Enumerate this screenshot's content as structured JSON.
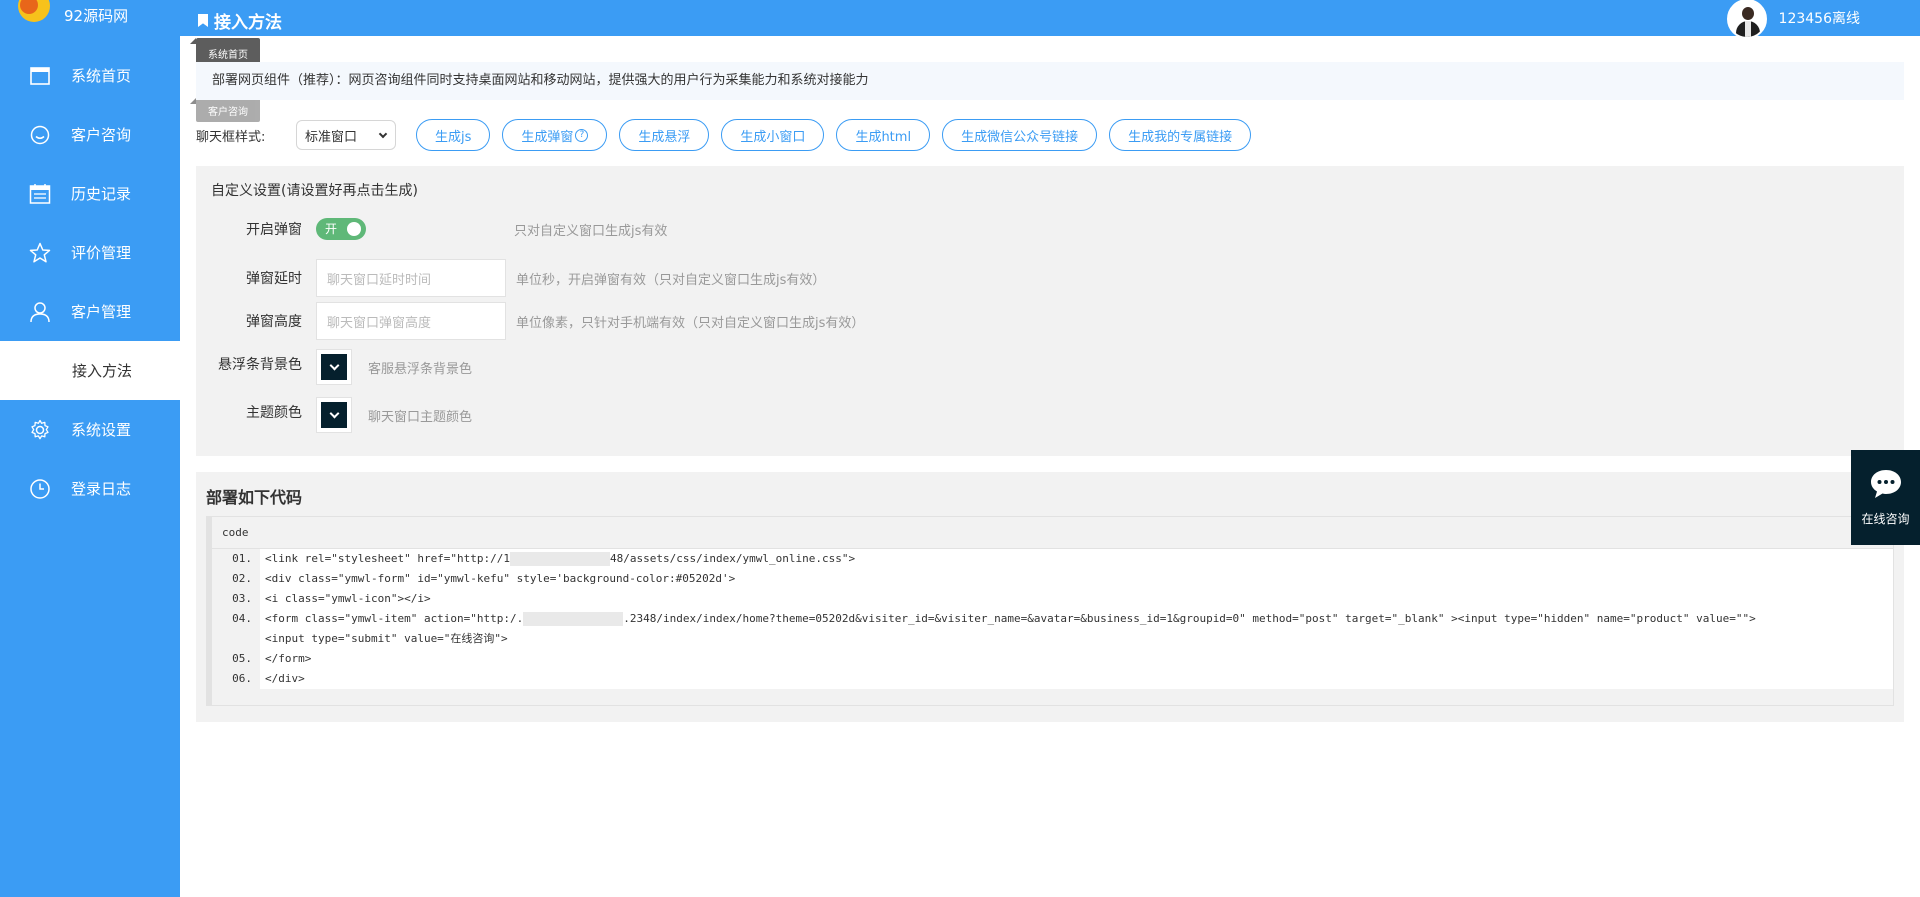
{
  "brand": {
    "name": "92源码网"
  },
  "sidebar": {
    "items": [
      {
        "label": "系统首页",
        "icon": "window-icon"
      },
      {
        "label": "客户咨询",
        "icon": "smile-icon"
      },
      {
        "label": "历史记录",
        "icon": "calendar-list-icon"
      },
      {
        "label": "评价管理",
        "icon": "star-icon"
      },
      {
        "label": "客户管理",
        "icon": "user-icon"
      },
      {
        "label": "接入方法",
        "icon": ""
      },
      {
        "label": "系统设置",
        "icon": "gear-icon"
      },
      {
        "label": "登录日志",
        "icon": "clock-icon"
      }
    ],
    "active_index": 5
  },
  "tooltips": {
    "home": "系统首页",
    "consult": "客户咨询"
  },
  "header": {
    "title": "接入方法",
    "username": "123456离线"
  },
  "notice": "部署网页组件（推荐）：网页咨询组件同时支持桌面网站和移动网站，提供强大的用户行为采集能力和系统对接能力",
  "generator": {
    "label": "聊天框样式:",
    "style_select": "标准窗口",
    "buttons": [
      "生成js",
      "生成弹窗",
      "生成悬浮",
      "生成小窗口",
      "生成html",
      "生成微信公众号链接",
      "生成我的专属链接"
    ],
    "help_mark": "?"
  },
  "custom": {
    "title": "自定义设置(请设置好再点击生成)",
    "popup": {
      "label": "开启弹窗",
      "toggle_text": "开",
      "enabled": true,
      "hint": "只对自定义窗口生成js有效"
    },
    "delay": {
      "label": "弹窗延时",
      "placeholder": "聊天窗口延时时间",
      "hint": "单位秒，开启弹窗有效（只对自定义窗口生成js有效）"
    },
    "height": {
      "label": "弹窗高度",
      "placeholder": "聊天窗口弹窗高度",
      "hint": "单位像素，只针对手机端有效（只对自定义窗口生成js有效）"
    },
    "float_bg": {
      "label": "悬浮条背景色",
      "hint": "客服悬浮条背景色",
      "color": "#05202d"
    },
    "theme": {
      "label": "主题颜色",
      "hint": "聊天窗口主题颜色",
      "color": "#05202d"
    }
  },
  "code": {
    "title": "部署如下代码",
    "lang": "code",
    "lines": [
      {
        "no": "01.",
        "pre": "<link rel=\"stylesheet\" href=\"http://1",
        "post": "48/assets/css/index/ymwl_online.css\">"
      },
      {
        "no": "02.",
        "pre": "<div class=\"ymwl-form\" id=\"ymwl-kefu\" style='background-color:#05202d'>",
        "post": ""
      },
      {
        "no": "03.",
        "pre": "<i class=\"ymwl-icon\"></i>",
        "post": ""
      },
      {
        "no": "04.",
        "pre": "<form class=\"ymwl-item\" action=\"http:/.",
        "post": ".2348/index/index/home?theme=05202d&visiter_id=&visiter_name=&avatar=&business_id=1&groupid=0\" method=\"post\" target=\"_blank\" ><input type=\"hidden\" name=\"product\" value=\"\">"
      },
      {
        "no": "",
        "pre": "<input type=\"submit\" value=\"在线咨询\">",
        "post": ""
      },
      {
        "no": "05.",
        "pre": "</form>",
        "post": ""
      },
      {
        "no": "06.",
        "pre": "</div>",
        "post": ""
      }
    ]
  },
  "float_widget": {
    "label": "在线咨询",
    "bg_color": "#05202d"
  },
  "colors": {
    "primary": "#3b9cf4",
    "toggle_on": "#5fb878"
  }
}
